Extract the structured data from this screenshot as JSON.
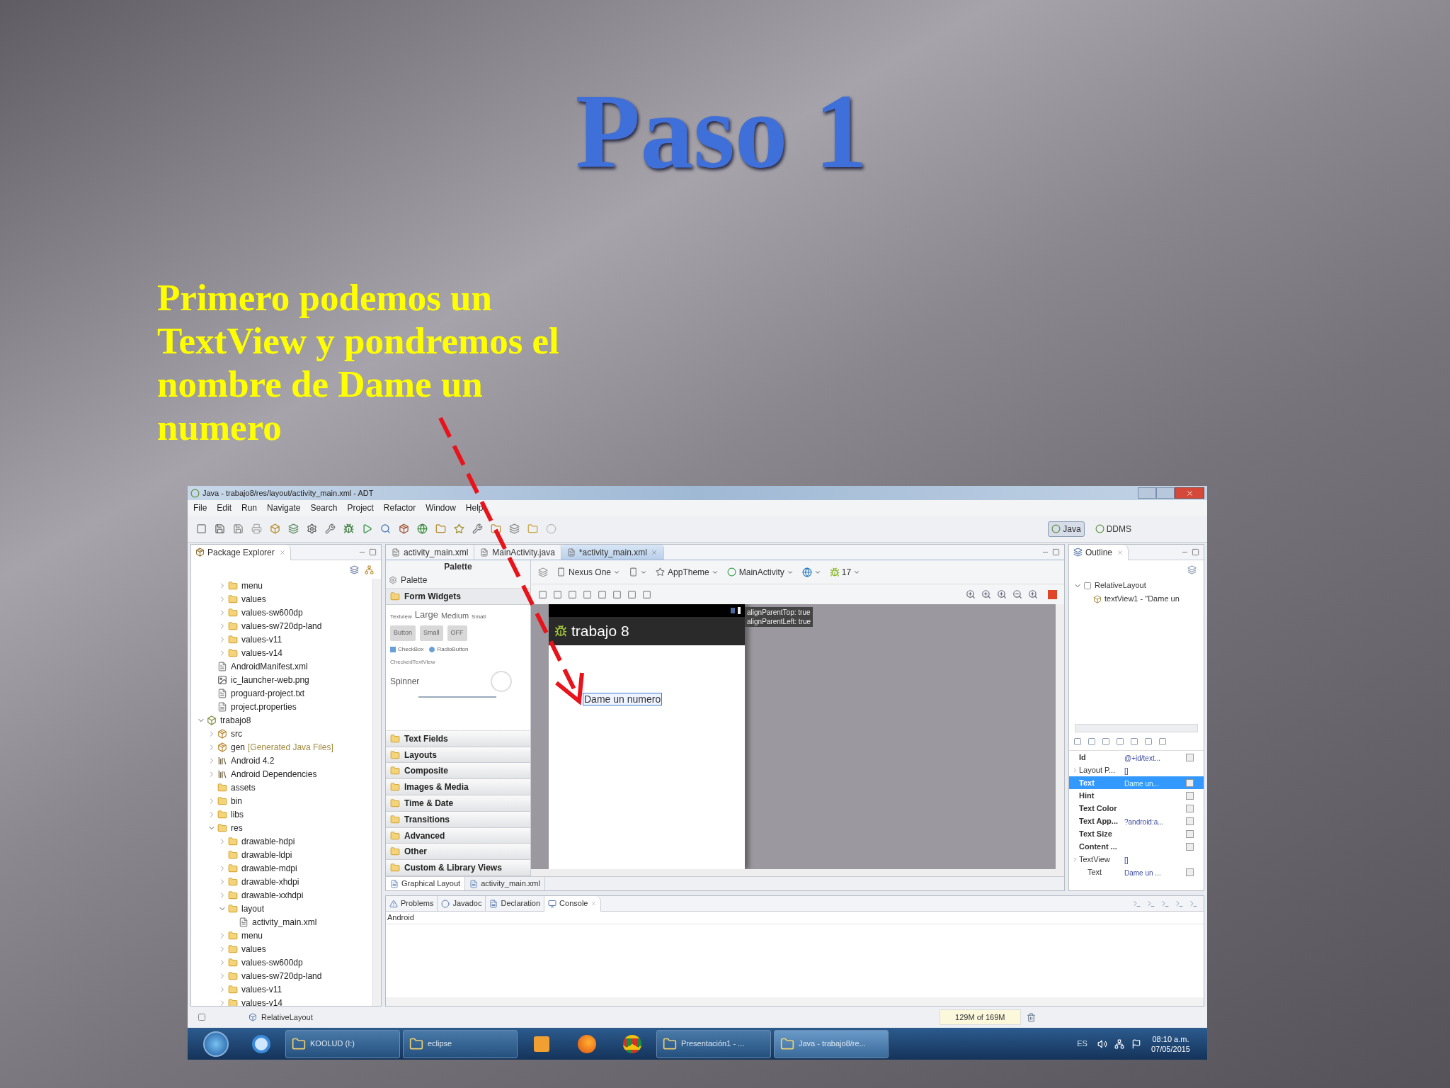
{
  "slide": {
    "title": "Paso 1",
    "body_lines": [
      "Primero podemos un",
      "TextView y pondremos el",
      "nombre de Dame un",
      "numero"
    ]
  },
  "window": {
    "title": "Java - trabajo8/res/layout/activity_main.xml - ADT",
    "menu": [
      "File",
      "Edit",
      "Run",
      "Navigate",
      "Search",
      "Project",
      "Refactor",
      "Window",
      "Help"
    ],
    "perspectives": [
      {
        "label": "Java",
        "selected": true
      },
      {
        "label": "DDMS",
        "selected": false
      }
    ]
  },
  "package_explorer": {
    "title": "Package Explorer",
    "tree": [
      {
        "children": [
          {
            "children": [
              {
                "label": "menu",
                "kind": "folder",
                "expanded": false
              },
              {
                "label": "values",
                "kind": "folder",
                "expanded": false
              },
              {
                "label": "values-sw600dp",
                "kind": "folder",
                "expanded": false
              },
              {
                "label": "values-sw720dp-land",
                "kind": "folder",
                "expanded": false
              },
              {
                "label": "values-v11",
                "kind": "folder",
                "expanded": false
              },
              {
                "label": "values-v14",
                "kind": "folder",
                "expanded": false
              }
            ]
          },
          {
            "label": "AndroidManifest.xml",
            "kind": "file"
          },
          {
            "label": "ic_launcher-web.png",
            "kind": "image"
          },
          {
            "label": "proguard-project.txt",
            "kind": "file"
          },
          {
            "label": "project.properties",
            "kind": "file"
          }
        ]
      },
      {
        "label": "trabajo8",
        "kind": "project",
        "expanded": true,
        "children": [
          {
            "label": "src",
            "kind": "package",
            "expanded": false
          },
          {
            "label": "gen",
            "note": "[Generated Java Files]",
            "kind": "package",
            "expanded": false
          },
          {
            "label": "Android 4.2",
            "kind": "library",
            "expanded": false
          },
          {
            "label": "Android Dependencies",
            "kind": "library",
            "expanded": false
          },
          {
            "label": "assets",
            "kind": "folder"
          },
          {
            "label": "bin",
            "kind": "folder",
            "expanded": false
          },
          {
            "label": "libs",
            "kind": "folder",
            "expanded": false
          },
          {
            "label": "res",
            "kind": "folder",
            "expanded": true,
            "children": [
              {
                "label": "drawable-hdpi",
                "kind": "folder",
                "expanded": false
              },
              {
                "label": "drawable-ldpi",
                "kind": "folder"
              },
              {
                "label": "drawable-mdpi",
                "kind": "folder",
                "expanded": false
              },
              {
                "label": "drawable-xhdpi",
                "kind": "folder",
                "expanded": false
              },
              {
                "label": "drawable-xxhdpi",
                "kind": "folder",
                "expanded": false
              },
              {
                "label": "layout",
                "kind": "folder",
                "expanded": true,
                "children": [
                  {
                    "label": "activity_main.xml",
                    "kind": "file"
                  }
                ]
              },
              {
                "label": "menu",
                "kind": "folder",
                "expanded": false
              },
              {
                "label": "values",
                "kind": "folder",
                "expanded": false
              },
              {
                "label": "values-sw600dp",
                "kind": "folder",
                "expanded": false
              },
              {
                "label": "values-sw720dp-land",
                "kind": "folder",
                "expanded": false
              },
              {
                "label": "values-v11",
                "kind": "folder",
                "expanded": false
              },
              {
                "label": "values-v14",
                "kind": "folder",
                "expanded": false
              }
            ]
          }
        ]
      }
    ]
  },
  "editor": {
    "tabs": [
      {
        "label": "activity_main.xml",
        "selected": false
      },
      {
        "label": "MainActivity.java",
        "selected": false
      },
      {
        "label": "*activity_main.xml",
        "selected": true
      }
    ],
    "palette": {
      "title": "Palette",
      "search": "Palette",
      "preview": {
        "label_row": [
          "Textview",
          "Large",
          "Medium",
          "Small"
        ],
        "buttons": [
          "Button",
          "Small",
          "OFF"
        ],
        "toggles": [
          {
            "label": "CheckBox",
            "kind": "checkbox",
            "checked": true
          },
          {
            "label": "RadioButton",
            "kind": "radio",
            "checked": true
          }
        ],
        "checked_text_view": "CheckedTextView",
        "spinner": "Spinner"
      },
      "groups": [
        {
          "label": "Form Widgets",
          "expanded": true
        },
        {
          "label": "Text Fields",
          "expanded": false
        },
        {
          "label": "Layouts",
          "expanded": false
        },
        {
          "label": "Composite",
          "expanded": false
        },
        {
          "label": "Images & Media",
          "expanded": false
        },
        {
          "label": "Time & Date",
          "expanded": false
        },
        {
          "label": "Transitions",
          "expanded": false
        },
        {
          "label": "Advanced",
          "expanded": false
        },
        {
          "label": "Other",
          "expanded": false
        },
        {
          "label": "Custom & Library Views",
          "expanded": false
        }
      ]
    },
    "layout_toolbar": {
      "device": "Nexus One",
      "theme": "AppTheme",
      "activity": "MainActivity",
      "api": "17"
    },
    "device": {
      "app_title": "trabajo 8",
      "text_view": "Dame un numero",
      "selected": true
    },
    "tooltip_lines": [
      "alignParentTop: true",
      "alignParentLeft: true"
    ],
    "bottom_tabs": [
      {
        "label": "Graphical Layout",
        "selected": true
      },
      {
        "label": "activity_main.xml",
        "selected": false
      }
    ]
  },
  "outline": {
    "title": "Outline",
    "tree": [
      {
        "label": "RelativeLayout",
        "expanded": true,
        "children": [
          {
            "label": "textView1 - \"Dame un"
          }
        ]
      }
    ],
    "properties": [
      {
        "name": "Id",
        "value": "@+id/text...",
        "kind": "property",
        "selected": false
      },
      {
        "name": "Layout P...",
        "value": "[]",
        "kind": "category",
        "selected": false
      },
      {
        "name": "Text",
        "value": "Dame un...",
        "kind": "property",
        "selected": true
      },
      {
        "name": "Hint",
        "kind": "property",
        "selected": false
      },
      {
        "name": "Text Color",
        "kind": "property",
        "selected": false
      },
      {
        "name": "Text App...",
        "value": "?android:a...",
        "kind": "property",
        "selected": false
      },
      {
        "name": "Text Size",
        "kind": "property",
        "selected": false
      },
      {
        "name": "Content ...",
        "kind": "property",
        "selected": false
      },
      {
        "name": "TextView",
        "value": "[]",
        "kind": "category",
        "selected": false
      },
      {
        "name": "Text",
        "value": "Dame un ...",
        "kind": "subproperty",
        "selected": false
      }
    ]
  },
  "console": {
    "tabs": [
      {
        "label": "Problems",
        "selected": false
      },
      {
        "label": "Javadoc",
        "selected": false
      },
      {
        "label": "Declaration",
        "selected": false
      },
      {
        "label": "Console",
        "selected": true
      }
    ],
    "header": "Android"
  },
  "status_bar": {
    "selection": "RelativeLayout",
    "memory": "129M of 169M"
  },
  "taskbar": {
    "items": [
      {
        "kind": "start"
      },
      {
        "kind": "pinned"
      },
      {
        "kind": "task",
        "label": "KOOLUD (I:)",
        "selected": false
      },
      {
        "kind": "task",
        "label": "eclipse",
        "selected": false
      },
      {
        "kind": "pinned"
      },
      {
        "kind": "pinned"
      },
      {
        "kind": "pinned"
      },
      {
        "kind": "task",
        "label": "Presentación1 - ...",
        "selected": false
      },
      {
        "kind": "task",
        "label": "Java - trabajo8/re...",
        "selected": true
      }
    ],
    "language": "ES",
    "time": "08:10 a.m.",
    "date": "07/05/2015"
  }
}
